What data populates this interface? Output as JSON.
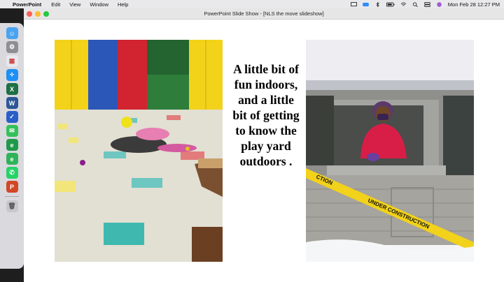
{
  "menubar": {
    "app_name": "PowerPoint",
    "menus": [
      "Edit",
      "View",
      "Window",
      "Help"
    ],
    "clock": "Mon Feb 28  12:27 PM"
  },
  "window": {
    "title": "PowerPoint Slide Show - [NLS the move slideshow]"
  },
  "slide": {
    "caption": "A little bit of fun indoors, and a little bit of getting to know the play yard outdoors .",
    "left_photo": "indoor-play-photo",
    "right_photo": "outdoor-playhouse-photo",
    "tape_text": "UNDER CONSTRUCTION"
  },
  "dock": {
    "icons": [
      "finder-icon",
      "system-preferences-icon",
      "launchpad-icon",
      "safari-icon",
      "excel-icon",
      "word-icon",
      "tasks-icon",
      "messages-icon",
      "evernote-icon",
      "evernote-2-icon",
      "whatsapp-icon",
      "powerpoint-icon",
      "trash-icon"
    ]
  },
  "colors": {
    "close": "#ff5f57",
    "minimize": "#febc2e",
    "zoom": "#28c840"
  }
}
